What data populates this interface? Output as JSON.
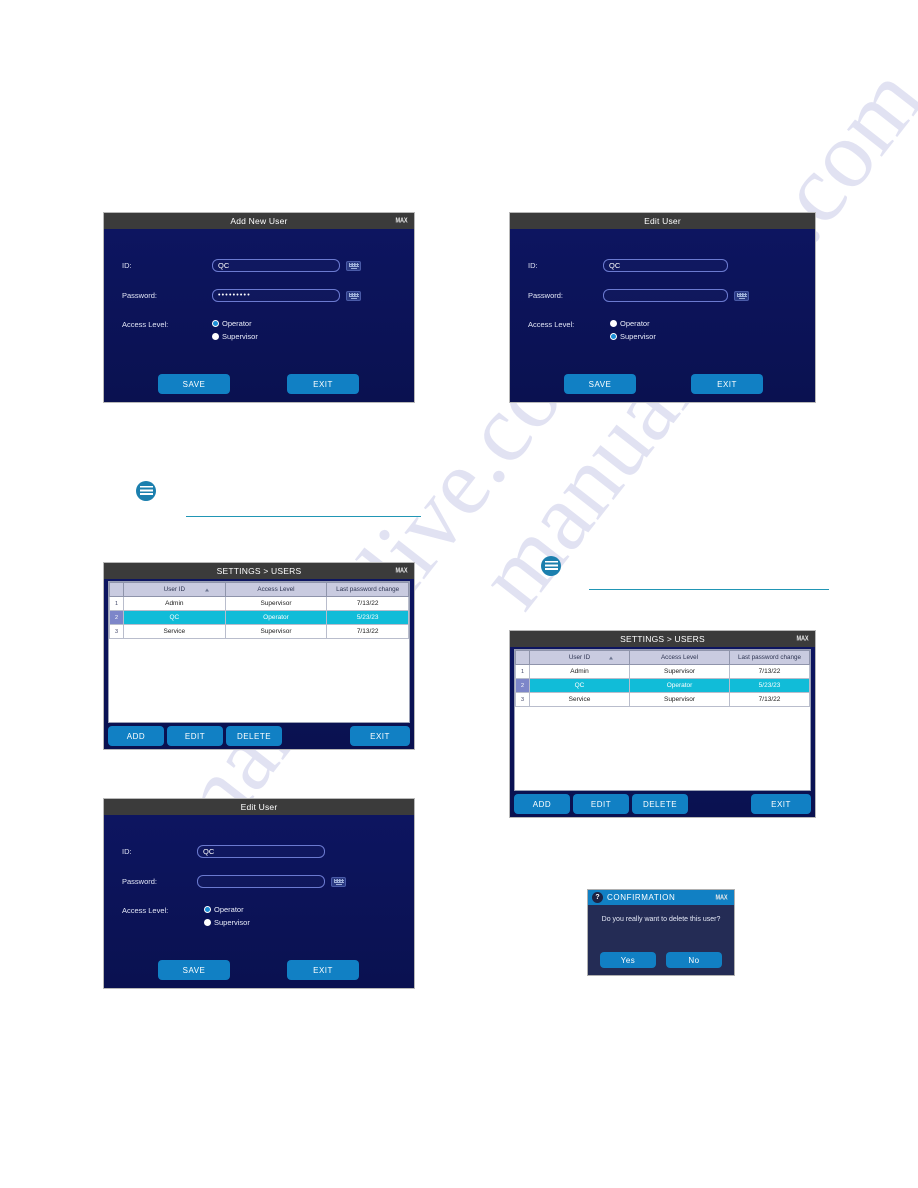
{
  "watermark": {
    "text": "manualslive.com"
  },
  "brand": {
    "logo": "MAX"
  },
  "panels": {
    "add_new_user": {
      "title": "Add New User",
      "fields": {
        "id_label": "ID:",
        "id_value": "QC",
        "password_label": "Password:",
        "password_value": "•••••••••",
        "access_label": "Access Level:"
      },
      "radios": [
        {
          "label": "Operator",
          "selected": true
        },
        {
          "label": "Supervisor",
          "selected": false
        }
      ],
      "buttons": {
        "save": "SAVE",
        "exit": "EXIT"
      }
    },
    "edit_user_top": {
      "title": "Edit User",
      "fields": {
        "id_label": "ID:",
        "id_value": "QC",
        "password_label": "Password:",
        "password_value": "",
        "access_label": "Access Level:"
      },
      "radios": [
        {
          "label": "Operator",
          "selected": false
        },
        {
          "label": "Supervisor",
          "selected": true
        }
      ],
      "buttons": {
        "save": "SAVE",
        "exit": "EXIT"
      }
    },
    "edit_user_bottom": {
      "title": "Edit User",
      "fields": {
        "id_label": "ID:",
        "id_value": "QC",
        "password_label": "Password:",
        "password_value": "",
        "access_label": "Access Level:"
      },
      "radios": [
        {
          "label": "Operator",
          "selected": true
        },
        {
          "label": "Supervisor",
          "selected": false
        }
      ],
      "buttons": {
        "save": "SAVE",
        "exit": "EXIT"
      }
    },
    "users_list_left": {
      "title": "SETTINGS > USERS",
      "columns": [
        "",
        "User ID",
        "Access Level",
        "Last password change"
      ],
      "rows": [
        {
          "num": "1",
          "user_id": "Admin",
          "access_level": "Supervisor",
          "last_change": "7/13/22",
          "selected": false
        },
        {
          "num": "2",
          "user_id": "QC",
          "access_level": "Operator",
          "last_change": "5/23/23",
          "selected": true
        },
        {
          "num": "3",
          "user_id": "Service",
          "access_level": "Supervisor",
          "last_change": "7/13/22",
          "selected": false
        }
      ],
      "buttons": {
        "add": "ADD",
        "edit": "EDIT",
        "delete": "DELETE",
        "exit": "EXIT"
      }
    },
    "users_list_right": {
      "title": "SETTINGS > USERS",
      "columns": [
        "",
        "User ID",
        "Access Level",
        "Last password change"
      ],
      "rows": [
        {
          "num": "1",
          "user_id": "Admin",
          "access_level": "Supervisor",
          "last_change": "7/13/22",
          "selected": false
        },
        {
          "num": "2",
          "user_id": "QC",
          "access_level": "Operator",
          "last_change": "5/23/23",
          "selected": true
        },
        {
          "num": "3",
          "user_id": "Service",
          "access_level": "Supervisor",
          "last_change": "7/13/22",
          "selected": false
        }
      ],
      "buttons": {
        "add": "ADD",
        "edit": "EDIT",
        "delete": "DELETE",
        "exit": "EXIT"
      }
    },
    "confirmation": {
      "title": "CONFIRMATION",
      "icon": "question-mark",
      "message": "Do you really want to delete this user?",
      "buttons": {
        "yes": "Yes",
        "no": "No"
      }
    }
  },
  "colors": {
    "screen_bg": "#0c1559",
    "header_bar": "#3b3b3b",
    "button_blue": "#1180c4",
    "selected_row": "#11bcd8",
    "note_accent": "#1b7fae"
  }
}
